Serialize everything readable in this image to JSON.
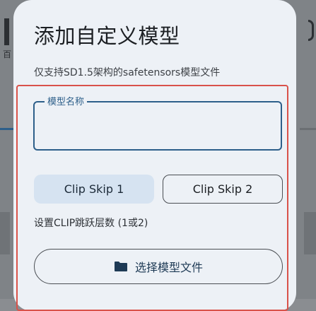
{
  "background": {
    "left_text": "百",
    "scrim_color": "#7f8387"
  },
  "dialog": {
    "title": "添加自定义模型",
    "subtitle": "仅支持SD1.5架构的safetensors模型文件",
    "name_field": {
      "label": "模型名称",
      "value": ""
    },
    "clip_skip": {
      "options": [
        "Clip Skip 1",
        "Clip Skip 2"
      ],
      "selected": "Clip Skip 1",
      "help": "设置CLIP跳跃层数 (1或2)"
    },
    "choose_file_button": {
      "label": "选择模型文件",
      "icon": "folder-icon"
    }
  },
  "colors": {
    "accent": "#2d5f8a",
    "selected_bg": "#d6e3f1",
    "highlight_outline": "#d9524a",
    "dialog_bg": "#edf1f6"
  }
}
